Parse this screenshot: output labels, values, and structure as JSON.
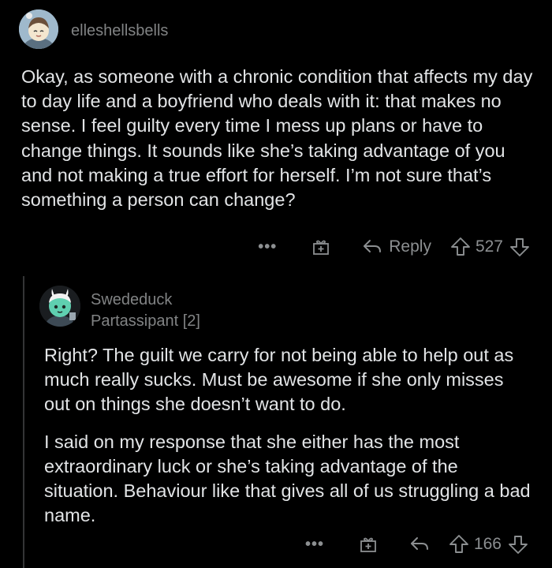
{
  "comment": {
    "username": "elleshellsbells",
    "avatar_icon": "snoo-avatar-icon",
    "body": "Okay, as someone with a chronic condition that affects my day to day life and a boyfriend who deals with it: that makes no sense. I feel guilty every time I mess up plans or have to change things. It sounds like she’s taking advantage of you and not making a true effort for herself. I’m not sure that’s something a person can change?",
    "actions": {
      "more_label": "•••",
      "reply_label": "Reply",
      "score": "527"
    }
  },
  "reply": {
    "username": "Swededuck",
    "flair": "Partassipant [2]",
    "avatar_icon": "snoo-avatar-icon",
    "paragraphs": [
      "Right? The guilt we carry for not being able to help out as much really sucks. Must be awesome if she only misses out on things she doesn’t want to do.",
      "I said on my response that she either has the most extraordinary luck or she’s taking advantage of the situation. Behaviour like that gives all of us struggling a bad name."
    ],
    "actions": {
      "more_label": "•••",
      "score": "166"
    }
  },
  "colors": {
    "background": "#000000",
    "text": "#e2e4e6",
    "muted": "#818384",
    "thread_line": "#343536"
  }
}
